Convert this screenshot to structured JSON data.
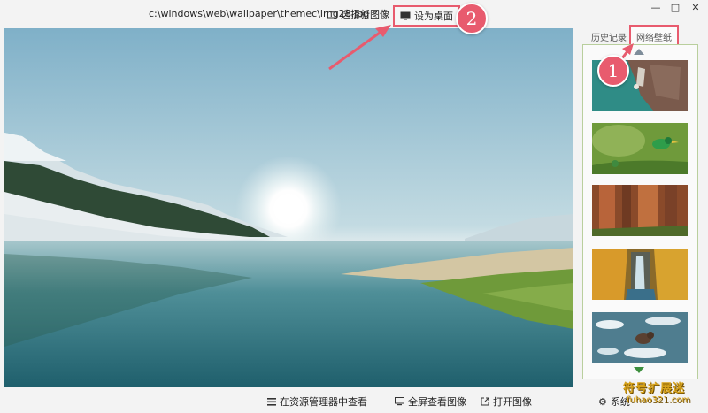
{
  "topbar": {
    "path": "c:\\windows\\web\\wallpaper\\themec\\img28.jpg",
    "select_new_label": "选择新图像",
    "set_desktop_label": "设为桌面",
    "min_glyph": "—",
    "max_glyph": "□",
    "close_glyph": "✕"
  },
  "panel": {
    "tab_history": "历史记录",
    "tab_network": "网络壁纸"
  },
  "markers": {
    "step1": "1",
    "step2": "2"
  },
  "bottom": {
    "explorer_label": "在资源管理器中查看",
    "fullscreen_label": "全屏查看图像",
    "open_label": "打开图像",
    "settings_label": "系统"
  },
  "watermark": {
    "line1": "符号扩展迷",
    "line2": "fuhao321.com"
  },
  "icons": {
    "folder": "folder-icon",
    "monitor": "monitor-icon",
    "list": "list-icon",
    "fullscreen": "monitor-icon",
    "open": "open-external-icon",
    "settings": "gear-icon"
  },
  "colors": {
    "highlight": "#e85b6e",
    "list_border": "#b9cf9d",
    "scroll_down": "#3d8f3e"
  }
}
